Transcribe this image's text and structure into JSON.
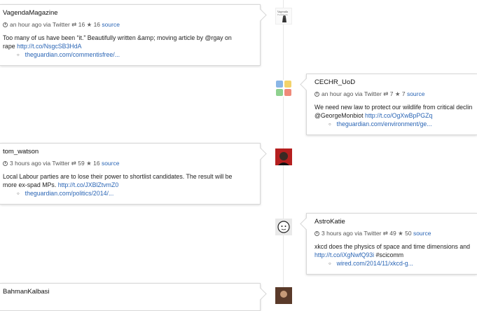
{
  "tweets": [
    {
      "user": "VagendaMagazine",
      "time": "an hour ago",
      "via": "via Twitter",
      "retweets": "16",
      "favorites": "16",
      "source_label": "source",
      "text_line1": "Too many of us have been “it.” Beautifully written &amp; moving article by @rgay on",
      "text_line2": "rape",
      "text_link": "http://t.co/NsgcSB3HdA",
      "links": [
        "theguardian.com/commentisfree/..."
      ]
    },
    {
      "user": "CECHR_UoD",
      "time": "an hour ago",
      "via": "via Twitter",
      "retweets": "7",
      "favorites": "7",
      "source_label": "source",
      "text_line1": "We need new law to protect our wildlife from critical declin",
      "text_line2": "@GeorgeMonbiot",
      "text_link": "http://t.co/OgXwBpPGZq",
      "links": [
        "theguardian.com/environment/ge..."
      ]
    },
    {
      "user": "tom_watson",
      "time": "3 hours ago",
      "via": "via Twitter",
      "retweets": "59",
      "favorites": "16",
      "source_label": "source",
      "text_line1": "Local Labour parties are to lose their power to shortlist candidates. The result will be",
      "text_line2": "more ex-spad MPs.",
      "text_link": "http://t.co/JXBlZtvmZ0",
      "links": [
        "theguardian.com/politics/2014/..."
      ]
    },
    {
      "user": "AstroKatie",
      "time": "3 hours ago",
      "via": "via Twitter",
      "retweets": "49",
      "favorites": "50",
      "source_label": "source",
      "text_line1": "xkcd does the physics of space and time dimensions and",
      "text_line2": "#scicomm",
      "text_link": "http://t.co/iXgNwfQ93i",
      "links": [
        "wired.com/2014/11/xkcd-g..."
      ]
    },
    {
      "user": "BahmanKalbasi"
    }
  ],
  "avatar_caption": "Vagenda Feminism",
  "icons": {
    "clock": "clock-icon",
    "retweet": "retweet-icon",
    "favorite": "star-icon"
  },
  "colors": {
    "link": "#2a65b5",
    "card_border": "#d8d8d8"
  }
}
